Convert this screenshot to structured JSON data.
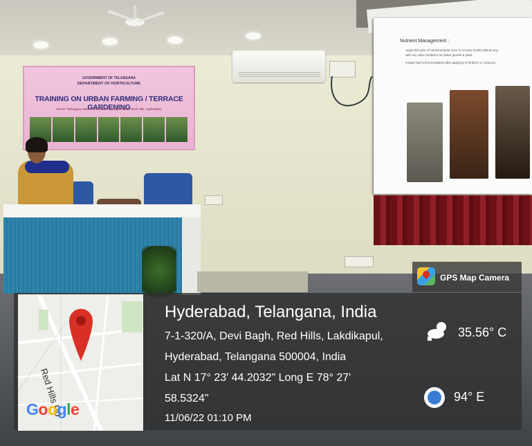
{
  "banner": {
    "dept_line1": "GOVERNMENT OF TELANGANA",
    "dept_line2": "DEPARTMENT OF HORTICULTURE",
    "title": "TRAINING ON URBAN FARMING / TERRACE GARDENING",
    "venue": "Venue: Telangana State Horticulture Training Institute, Red Hills, Hyderabad."
  },
  "slide": {
    "title": "Nutrient Management :",
    "bullet1": "Apply 500 gms of Vermicompost once in a every month without any",
    "bullet1b": "with any other fertilizers for better growth & yield.",
    "bullet2": "Irrigate bed soil immediately after applying of fertilizer or compost."
  },
  "overlay": {
    "app_name": "GPS Map Camera",
    "city": "Hyderabad, Telangana, India",
    "address_line1": "7-1-320/A, Devi Bagh, Red Hills, Lakdikapul,",
    "address_line2": "Hyderabad, Telangana 500004, India",
    "coords_line1": "Lat N 17° 23' 44.2032\" Long E 78° 27'",
    "coords_line2": "58.5324\"",
    "datetime": "11/06/22 01:10 PM",
    "temperature": "35.56° C",
    "heading": "94° E",
    "map_road": "Red Hills Rd",
    "map_brand": "Google",
    "pin_color": "#d93025"
  }
}
